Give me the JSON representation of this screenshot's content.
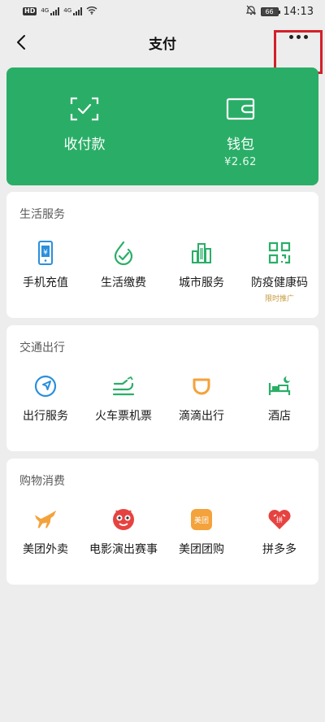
{
  "status_bar": {
    "hd": "HD",
    "sim1": "4G",
    "sim2": "4G",
    "battery": "66",
    "time": "14:13"
  },
  "nav": {
    "title": "支付"
  },
  "pay_card": {
    "receive_label": "收付款",
    "wallet_label": "钱包",
    "wallet_balance": "¥2.62"
  },
  "sections": {
    "life": {
      "title": "生活服务",
      "items": [
        {
          "label": "手机充值",
          "icon": "phone-recharge-icon"
        },
        {
          "label": "生活缴费",
          "icon": "utility-payment-icon"
        },
        {
          "label": "城市服务",
          "icon": "city-service-icon"
        },
        {
          "label": "防疫健康码",
          "icon": "health-code-icon",
          "tag": "限时推广"
        }
      ]
    },
    "travel": {
      "title": "交通出行",
      "items": [
        {
          "label": "出行服务",
          "icon": "travel-service-icon"
        },
        {
          "label": "火车票机票",
          "icon": "train-plane-ticket-icon"
        },
        {
          "label": "滴滴出行",
          "icon": "didi-icon"
        },
        {
          "label": "酒店",
          "icon": "hotel-icon"
        }
      ]
    },
    "shopping": {
      "title": "购物消费",
      "items": [
        {
          "label": "美团外卖",
          "icon": "meituan-delivery-icon"
        },
        {
          "label": "电影演出赛事",
          "icon": "movie-show-icon"
        },
        {
          "label": "美团团购",
          "icon": "meituan-group-buy-icon",
          "badge_text": "美团"
        },
        {
          "label": "拼多多",
          "icon": "pinduoduo-icon",
          "badge_text": "拼"
        }
      ]
    }
  },
  "colors": {
    "green": "#2aae67",
    "icon_green": "#2aae67",
    "icon_blue": "#2b8fdc",
    "icon_orange": "#f4a23b",
    "icon_red": "#e64340",
    "highlight": "#d2202a"
  }
}
